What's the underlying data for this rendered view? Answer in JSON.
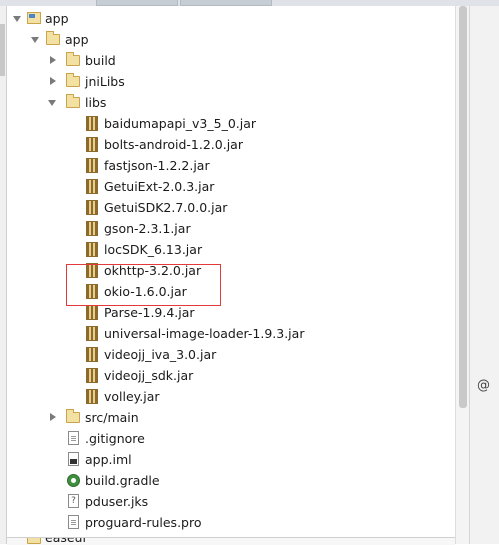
{
  "tree": {
    "root": "app",
    "module": "app",
    "folders": {
      "build": "build",
      "jniLibs": "jniLibs",
      "libs": "libs",
      "src_main": "src/main"
    },
    "libs_items": [
      "baidumapapi_v3_5_0.jar",
      "bolts-android-1.2.0.jar",
      "fastjson-1.2.2.jar",
      "GetuiExt-2.0.3.jar",
      "GetuiSDK2.7.0.0.jar",
      "gson-2.3.1.jar",
      "locSDK_6.13.jar",
      "okhttp-3.2.0.jar",
      "okio-1.6.0.jar",
      "Parse-1.9.4.jar",
      "universal-image-loader-1.9.3.jar",
      "videojj_iva_3.0.jar",
      "videojj_sdk.jar",
      "volley.jar"
    ],
    "files": {
      "gitignore": ".gitignore",
      "app_iml": "app.iml",
      "build_gradle": "build.gradle",
      "pduser": "pduser.jks",
      "proguard": "proguard-rules.pro"
    },
    "next_root": "easeui"
  },
  "side_symbol": "@",
  "highlight_color": "#e03a3a"
}
